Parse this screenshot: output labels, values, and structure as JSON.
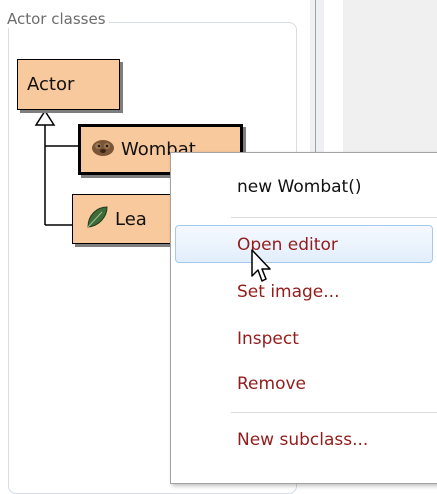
{
  "panel": {
    "title": "Actor classes"
  },
  "classes": [
    {
      "name": "Actor"
    },
    {
      "name": "Wombat",
      "icon": "wombat-icon"
    },
    {
      "name": "Lea",
      "icon": "leaf-icon"
    }
  ],
  "context_menu": {
    "items": [
      {
        "label": "new Wombat()"
      },
      {
        "label": "Open editor",
        "highlighted": true
      },
      {
        "label": "Set image..."
      },
      {
        "label": "Inspect"
      },
      {
        "label": "Remove"
      },
      {
        "label": "New subclass..."
      }
    ]
  },
  "colors": {
    "class_fill": "#f8c99c",
    "menu_item_text": "#931c1c",
    "highlight_border": "#a8c9ef"
  }
}
